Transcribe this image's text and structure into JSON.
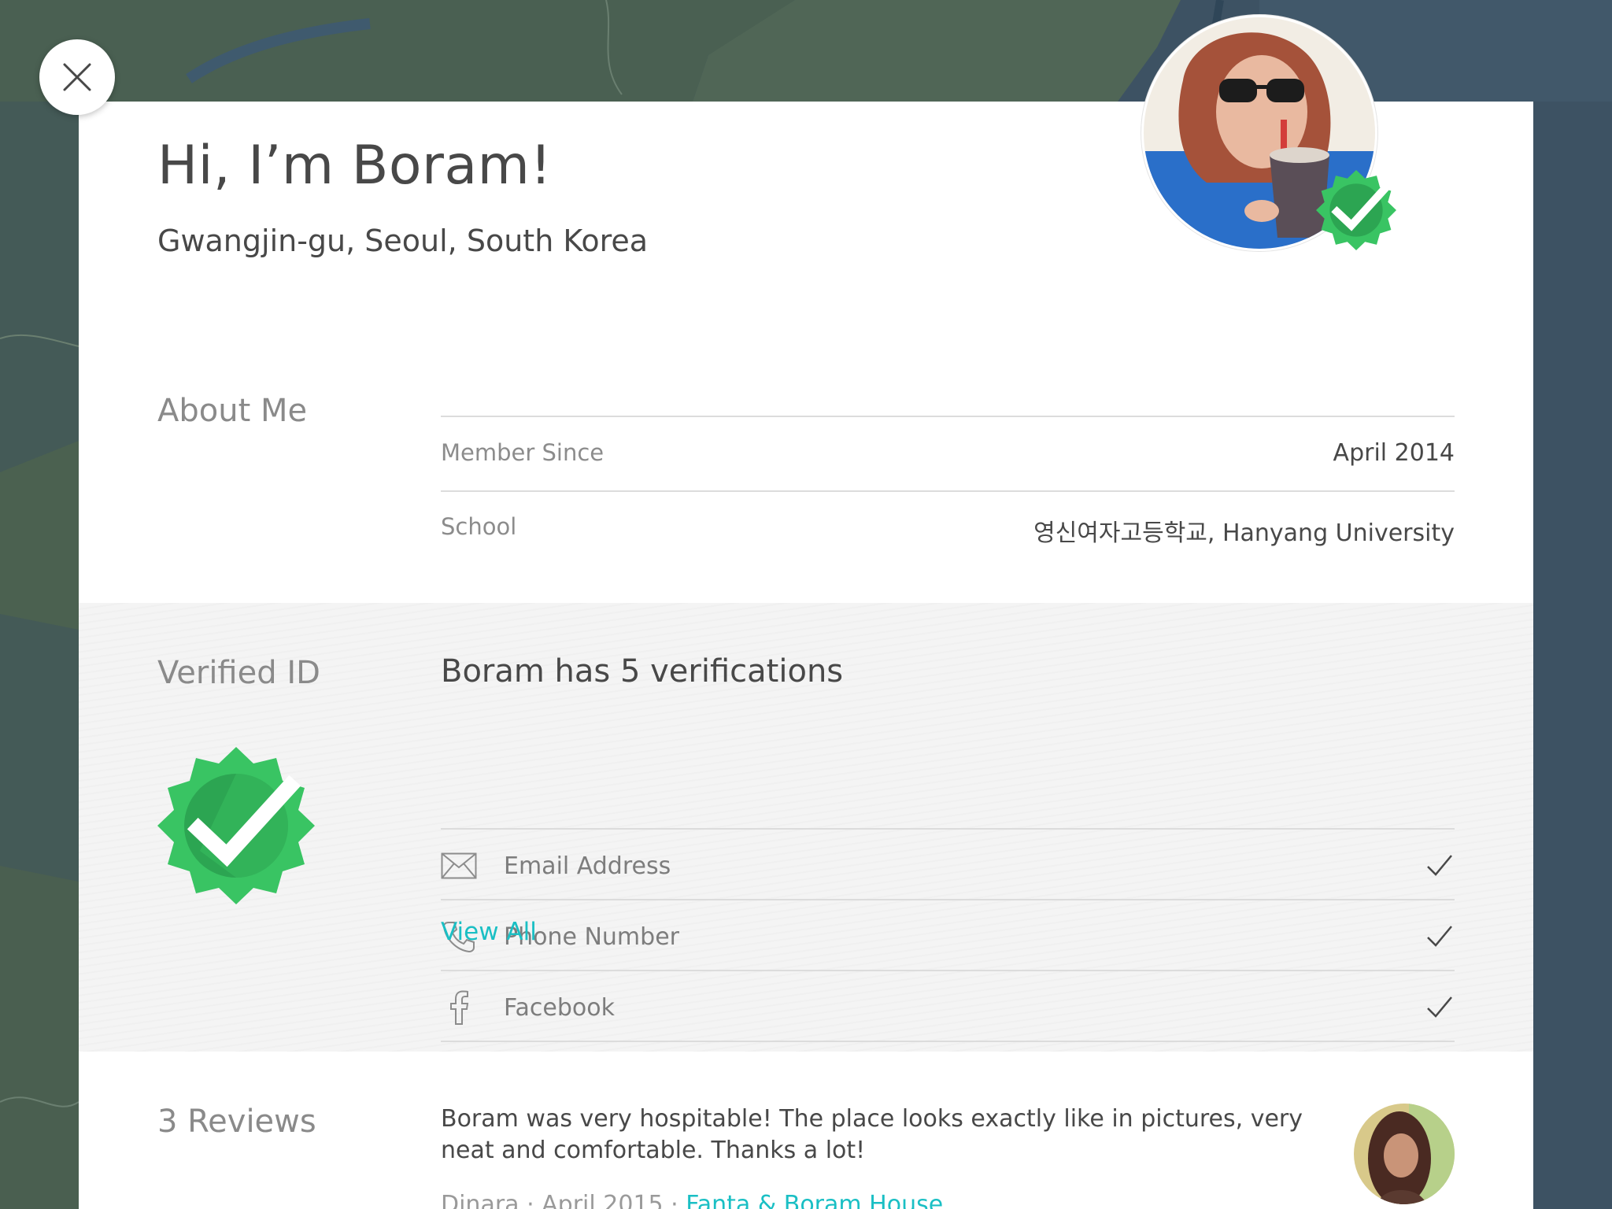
{
  "profile": {
    "greeting": "Hi, I’m Boram!",
    "location": "Gwangjin-gu, Seoul, South Korea"
  },
  "about": {
    "title": "About Me",
    "rows": [
      {
        "label": "Member Since",
        "value": "April 2014"
      },
      {
        "label": "School",
        "value": "영신여자고등학교, Hanyang University"
      }
    ]
  },
  "verified": {
    "title": "Verified ID",
    "summary": "Boram has 5 verifications",
    "items": [
      {
        "label": "Email Address",
        "icon": "envelope-icon"
      },
      {
        "label": "Phone Number",
        "icon": "phone-icon"
      },
      {
        "label": "Facebook",
        "icon": "facebook-icon"
      }
    ],
    "view_all": "View All"
  },
  "reviews": {
    "title": "3 Reviews",
    "first": {
      "text": "Boram was very hospitable! The place looks exactly like in pictures, very neat and comfortable. Thanks a lot!",
      "reviewer_and_date": "Dinara · April 2015 · ",
      "listing": "Fanta & Boram House"
    }
  },
  "colors": {
    "accent": "#1abfc4",
    "badge_green": "#2ecc71",
    "map_background": "#3d5263"
  }
}
